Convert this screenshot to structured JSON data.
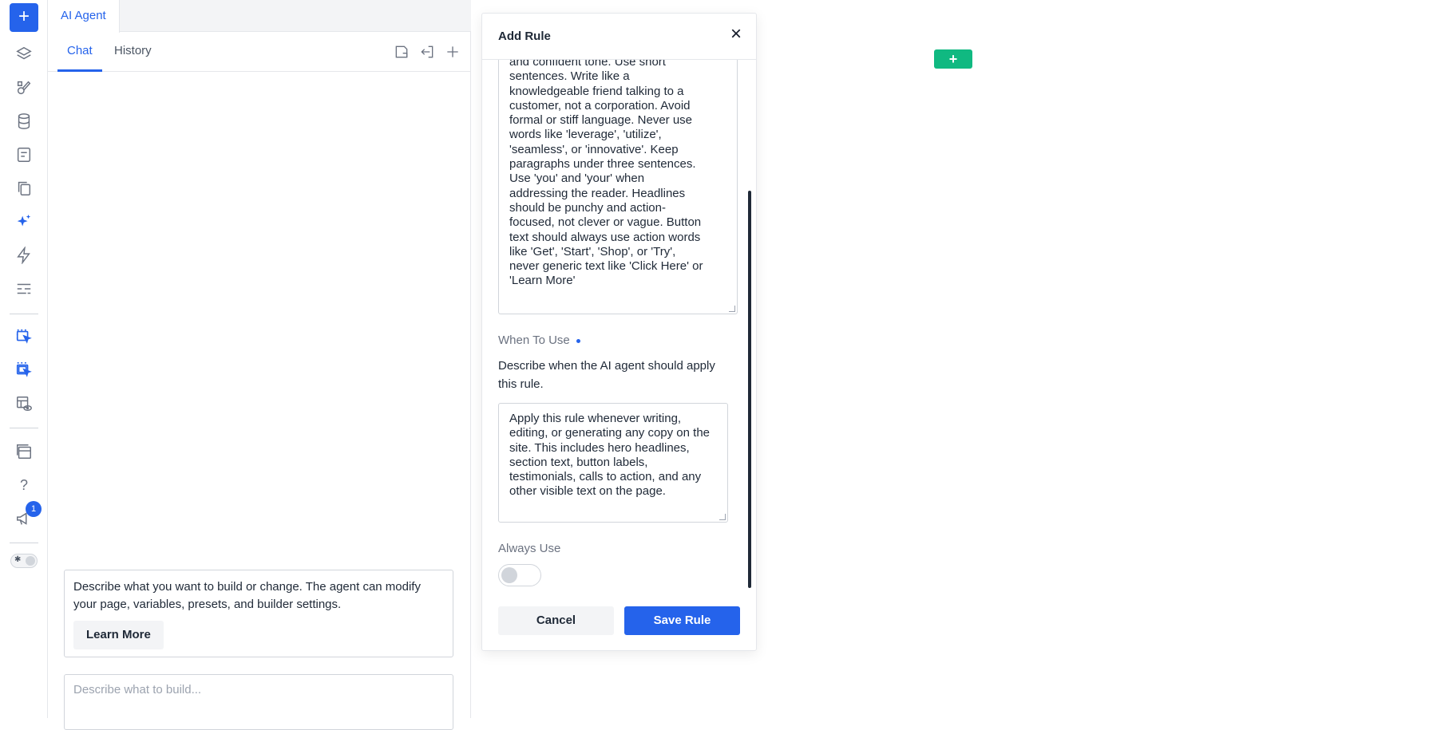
{
  "rail": {
    "add_label": "+",
    "badge_count": "1",
    "icons": [
      "layers-icon",
      "paint-icon",
      "database-icon",
      "form-icon",
      "copy-icon",
      "sparkles-icon",
      "lightning-icon",
      "sliders-icon",
      "select-cursor-icon",
      "select-multi-cursor-icon",
      "preview-icon",
      "templates-icon",
      "help-icon",
      "megaphone-icon"
    ]
  },
  "panel": {
    "tab_label": "AI Agent",
    "subtabs": {
      "chat": "Chat",
      "history": "History"
    },
    "info_text": "Describe what you want to build or change. The agent can modify your page, variables, presets, and builder settings.",
    "learn_more": "Learn More",
    "prompt_placeholder": "Describe what to build..."
  },
  "modal": {
    "title": "Add Rule",
    "close_icon": "×",
    "rule_text_lines": [
      "and confident tone. Use short",
      "sentences. Write like a",
      "knowledgeable friend talking to a",
      "customer, not a corporation. Avoid",
      "formal or stiff language. Never use",
      "words like 'leverage', 'utilize',",
      "'seamless', or 'innovative'. Keep",
      "paragraphs under three sentences.",
      "Use 'you' and 'your' when",
      "addressing the reader. Headlines",
      "should be punchy and action-",
      "focused, not clever or vague. Button",
      "text should always use action words",
      "like 'Get', 'Start', 'Shop', or 'Try',",
      "never generic text like 'Click Here' or",
      "'Learn More'"
    ],
    "when_label": "When To Use",
    "when_desc": "Describe when the AI agent should apply this rule.",
    "when_text": "Apply this rule whenever writing, editing, or generating any copy on the site. This includes hero headlines, section text, button labels, testimonials, calls to action, and any other visible text on the page.",
    "always_label": "Always Use",
    "always_on": false,
    "cancel": "Cancel",
    "save": "Save Rule"
  },
  "canvas": {
    "add_label": "+"
  },
  "colors": {
    "accent": "#2563eb",
    "canvas_add": "#10b981"
  }
}
